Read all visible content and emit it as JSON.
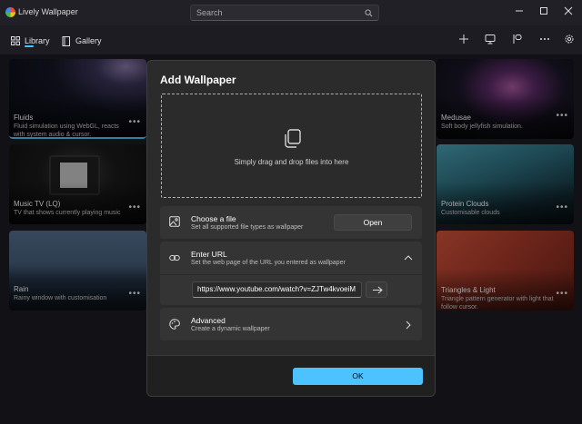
{
  "app": {
    "title": "Lively Wallpaper"
  },
  "search": {
    "placeholder": "Search"
  },
  "nav": {
    "tabs": [
      {
        "label": "Library",
        "icon": "grid-icon"
      },
      {
        "label": "Gallery",
        "icon": "book-icon"
      }
    ]
  },
  "toolbar": {
    "icons": [
      "add-icon",
      "monitor-icon",
      "control-panel-icon",
      "more-icon",
      "settings-gear-icon"
    ]
  },
  "cards": [
    {
      "title": "Fluids",
      "desc": "Fluid simulation using WebGL, reacts with system audio & cursor.",
      "selected": true
    },
    {
      "title": "Music TV (LQ)",
      "desc": "TV that shows currently playing music"
    },
    {
      "title": "Rain",
      "desc": "Rainy window with customisation"
    },
    {
      "title": "Medusae",
      "desc": "Soft body jellyfish simulation."
    },
    {
      "title": "Protein Clouds",
      "desc": "Customisable clouds"
    },
    {
      "title": "Triangles & Light",
      "desc": "Triangle pattern generator with light that follow cursor."
    }
  ],
  "more_glyph": "•••",
  "dialog": {
    "title": "Add Wallpaper",
    "drop_text": "Simply drag and drop files into here",
    "file": {
      "title": "Choose a file",
      "desc": "Set all supported file types as wallpaper",
      "button": "Open"
    },
    "url": {
      "title": "Enter URL",
      "desc": "Set the web page of the URL you entered as wallpaper",
      "value": "https://www.youtube.com/watch?v=ZJTw4kvoeiM"
    },
    "advanced": {
      "title": "Advanced",
      "desc": "Create a dynamic wallpaper"
    },
    "ok": "OK"
  },
  "colors": {
    "accent": "#4cc2ff",
    "background": "#1c1c22",
    "dialog": "#2b2b2b"
  }
}
